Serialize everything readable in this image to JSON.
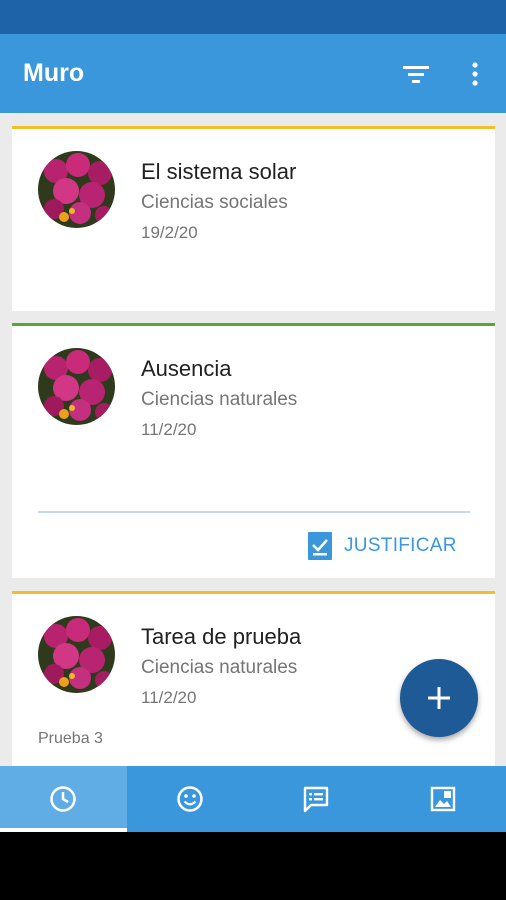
{
  "app": {
    "title": "Muro"
  },
  "toolbar": {
    "filter_icon": "filter-icon",
    "more_icon": "more-vert-icon"
  },
  "cards": [
    {
      "title": "El sistema solar",
      "subject": "Ciencias sociales",
      "date": "19/2/20",
      "accent": "#f3bd2d"
    },
    {
      "title": "Ausencia",
      "subject": "Ciencias naturales",
      "date": "11/2/20",
      "accent": "#5aa631",
      "action": "JUSTIFICAR"
    },
    {
      "title": "Tarea de prueba",
      "subject": "Ciencias naturales",
      "date": "11/2/20",
      "accent": "#f3bd2d",
      "note": "Prueba 3"
    }
  ],
  "fab": {
    "icon": "plus-icon"
  },
  "bottom_nav": [
    {
      "icon": "clock-icon",
      "active": true
    },
    {
      "icon": "smiley-icon",
      "active": false
    },
    {
      "icon": "chat-icon",
      "active": false
    },
    {
      "icon": "image-icon",
      "active": false
    }
  ],
  "colors": {
    "primary": "#3a97dc",
    "primary_dark": "#1e63a8",
    "fab": "#1d5a96"
  }
}
